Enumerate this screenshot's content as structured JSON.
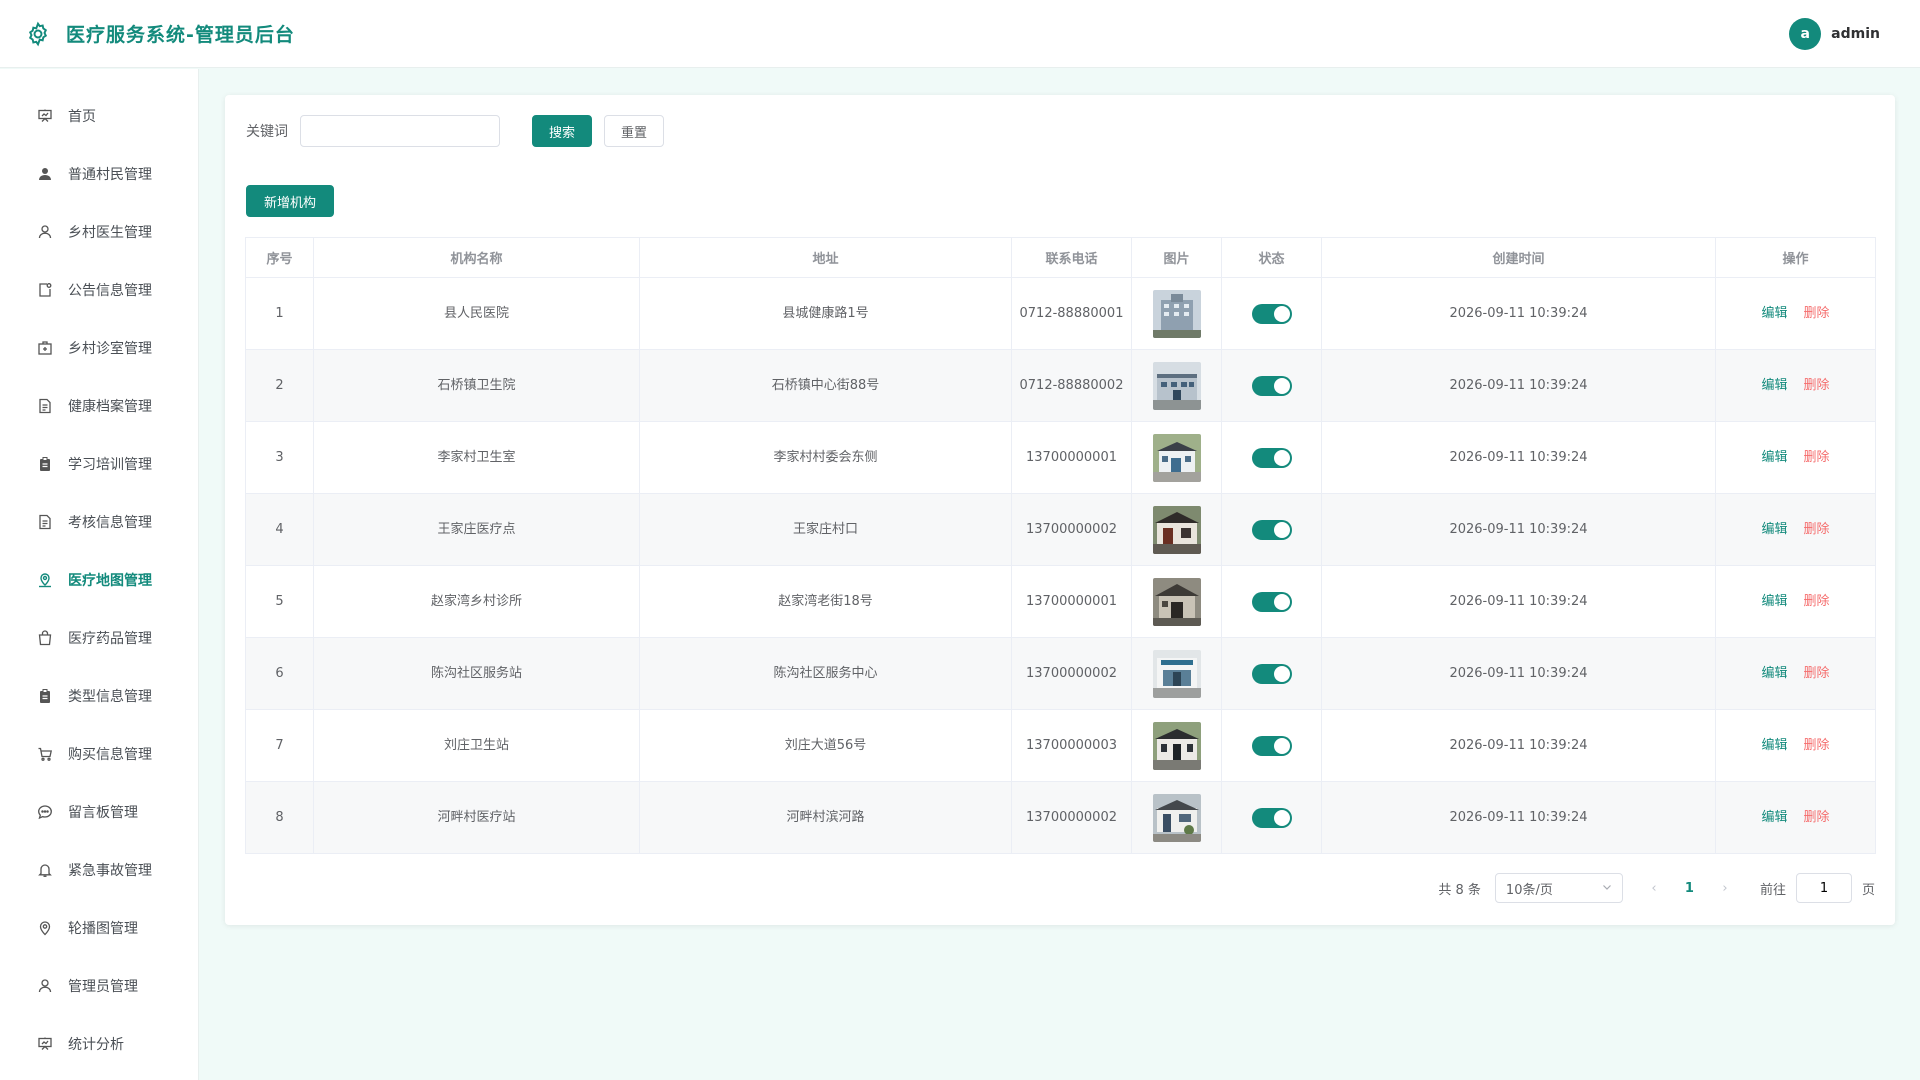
{
  "header": {
    "logo_icon": "gear-icon",
    "title": "医疗服务系统-管理员后台",
    "user": {
      "avatar_letter": "a",
      "name": "admin"
    }
  },
  "sidebar": {
    "items": [
      {
        "label": "首页",
        "icon": "presentation-icon",
        "active": false
      },
      {
        "label": "普通村民管理",
        "icon": "user-filled-icon",
        "active": false
      },
      {
        "label": "乡村医生管理",
        "icon": "user-icon",
        "active": false
      },
      {
        "label": "公告信息管理",
        "icon": "notice-icon",
        "active": false
      },
      {
        "label": "乡村诊室管理",
        "icon": "first-aid-icon",
        "active": false
      },
      {
        "label": "健康档案管理",
        "icon": "document-icon",
        "active": false
      },
      {
        "label": "学习培训管理",
        "icon": "clipboard-icon",
        "active": false
      },
      {
        "label": "考核信息管理",
        "icon": "document-icon",
        "active": false
      },
      {
        "label": "医疗地图管理",
        "icon": "map-location-icon",
        "active": true
      },
      {
        "label": "医疗药品管理",
        "icon": "shopping-bag-icon",
        "active": false
      },
      {
        "label": "类型信息管理",
        "icon": "clipboard-icon",
        "active": false
      },
      {
        "label": "购买信息管理",
        "icon": "shopping-cart-icon",
        "active": false
      },
      {
        "label": "留言板管理",
        "icon": "chat-icon",
        "active": false
      },
      {
        "label": "紧急事故管理",
        "icon": "bell-icon",
        "active": false
      },
      {
        "label": "轮播图管理",
        "icon": "location-icon",
        "active": false
      },
      {
        "label": "管理员管理",
        "icon": "user-icon",
        "active": false
      },
      {
        "label": "统计分析",
        "icon": "presentation-icon",
        "active": false
      }
    ]
  },
  "search": {
    "label": "关键词",
    "value": "",
    "placeholder": "",
    "search_label": "搜索",
    "reset_label": "重置"
  },
  "toolbar": {
    "add_label": "新增机构"
  },
  "table": {
    "columns": [
      "序号",
      "机构名称",
      "地址",
      "联系电话",
      "图片",
      "状态",
      "创建时间",
      "操作"
    ],
    "edit_label": "编辑",
    "delete_label": "删除",
    "rows": [
      {
        "index": "1",
        "name": "县人民医院",
        "address": "县城健康路1号",
        "phone": "0712-88880001",
        "status_on": true,
        "created": "2026-09-11 10:39:24"
      },
      {
        "index": "2",
        "name": "石桥镇卫生院",
        "address": "石桥镇中心街88号",
        "phone": "0712-88880002",
        "status_on": true,
        "created": "2026-09-11 10:39:24"
      },
      {
        "index": "3",
        "name": "李家村卫生室",
        "address": "李家村村委会东侧",
        "phone": "13700000001",
        "status_on": true,
        "created": "2026-09-11 10:39:24"
      },
      {
        "index": "4",
        "name": "王家庄医疗点",
        "address": "王家庄村口",
        "phone": "13700000002",
        "status_on": true,
        "created": "2026-09-11 10:39:24"
      },
      {
        "index": "5",
        "name": "赵家湾乡村诊所",
        "address": "赵家湾老街18号",
        "phone": "13700000001",
        "status_on": true,
        "created": "2026-09-11 10:39:24"
      },
      {
        "index": "6",
        "name": "陈沟社区服务站",
        "address": "陈沟社区服务中心",
        "phone": "13700000002",
        "status_on": true,
        "created": "2026-09-11 10:39:24"
      },
      {
        "index": "7",
        "name": "刘庄卫生站",
        "address": "刘庄大道56号",
        "phone": "13700000003",
        "status_on": true,
        "created": "2026-09-11 10:39:24"
      },
      {
        "index": "8",
        "name": "河畔村医疗站",
        "address": "河畔村滨河路",
        "phone": "13700000002",
        "status_on": true,
        "created": "2026-09-11 10:39:24"
      }
    ]
  },
  "pagination": {
    "total_text": "共 8 条",
    "page_size": "10条/页",
    "current_page": "1",
    "goto_label": "前往",
    "goto_value": "1",
    "page_unit": "页"
  },
  "colors": {
    "accent": "#138a7c",
    "danger": "#f56c6c",
    "background": "#f0faf8"
  }
}
